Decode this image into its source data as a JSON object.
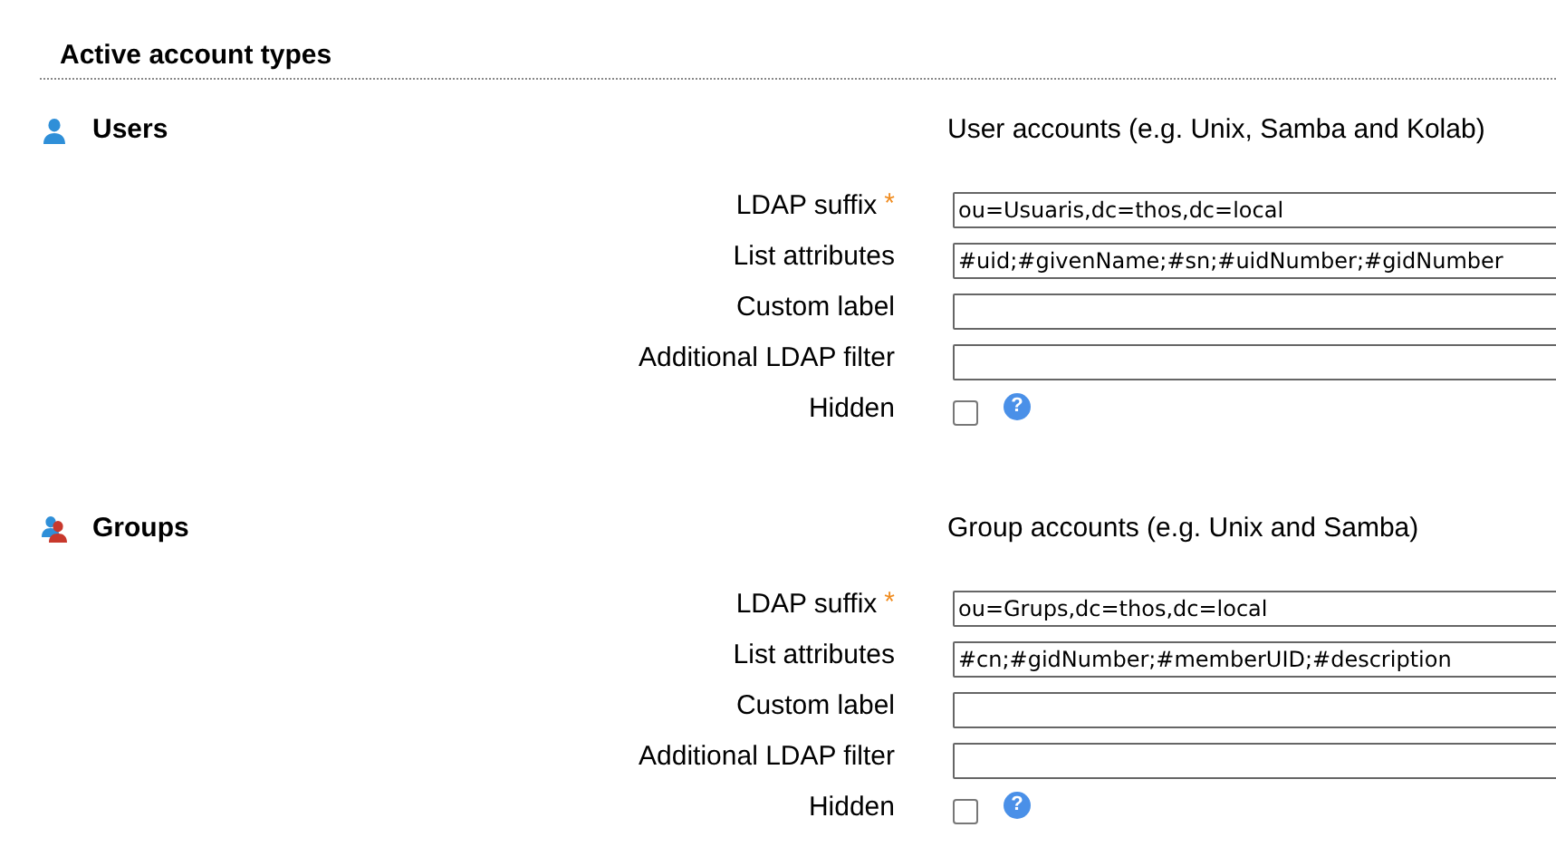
{
  "section": {
    "title": "Active account types"
  },
  "account_types": [
    {
      "kind": "users",
      "name": "Users",
      "description": "User accounts (e.g. Unix, Samba and Kolab)",
      "fields": [
        {
          "kind": "text",
          "label": "LDAP suffix",
          "marker": "*",
          "value": "ou=Usuaris,dc=thos,dc=local"
        },
        {
          "kind": "text",
          "label": "List attributes",
          "value": "#uid;#givenName;#sn;#uidNumber;#gidNumber"
        },
        {
          "kind": "text",
          "label": "Custom label"
        },
        {
          "kind": "text",
          "label": "Additional LDAP filter"
        },
        {
          "kind": "checkbox",
          "label": "Hidden",
          "checked": false,
          "help": "?"
        }
      ]
    },
    {
      "kind": "groups",
      "name": "Groups",
      "description": "Group accounts (e.g. Unix and Samba)",
      "fields": [
        {
          "kind": "text",
          "label": "LDAP suffix",
          "marker": "*",
          "value": "ou=Grups,dc=thos,dc=local"
        },
        {
          "kind": "text",
          "label": "List attributes",
          "value": "#cn;#gidNumber;#memberUID;#description"
        },
        {
          "kind": "text",
          "label": "Custom label"
        },
        {
          "kind": "text",
          "label": "Additional LDAP filter"
        },
        {
          "kind": "checkbox",
          "label": "Hidden",
          "checked": false,
          "help": "?"
        }
      ]
    }
  ]
}
